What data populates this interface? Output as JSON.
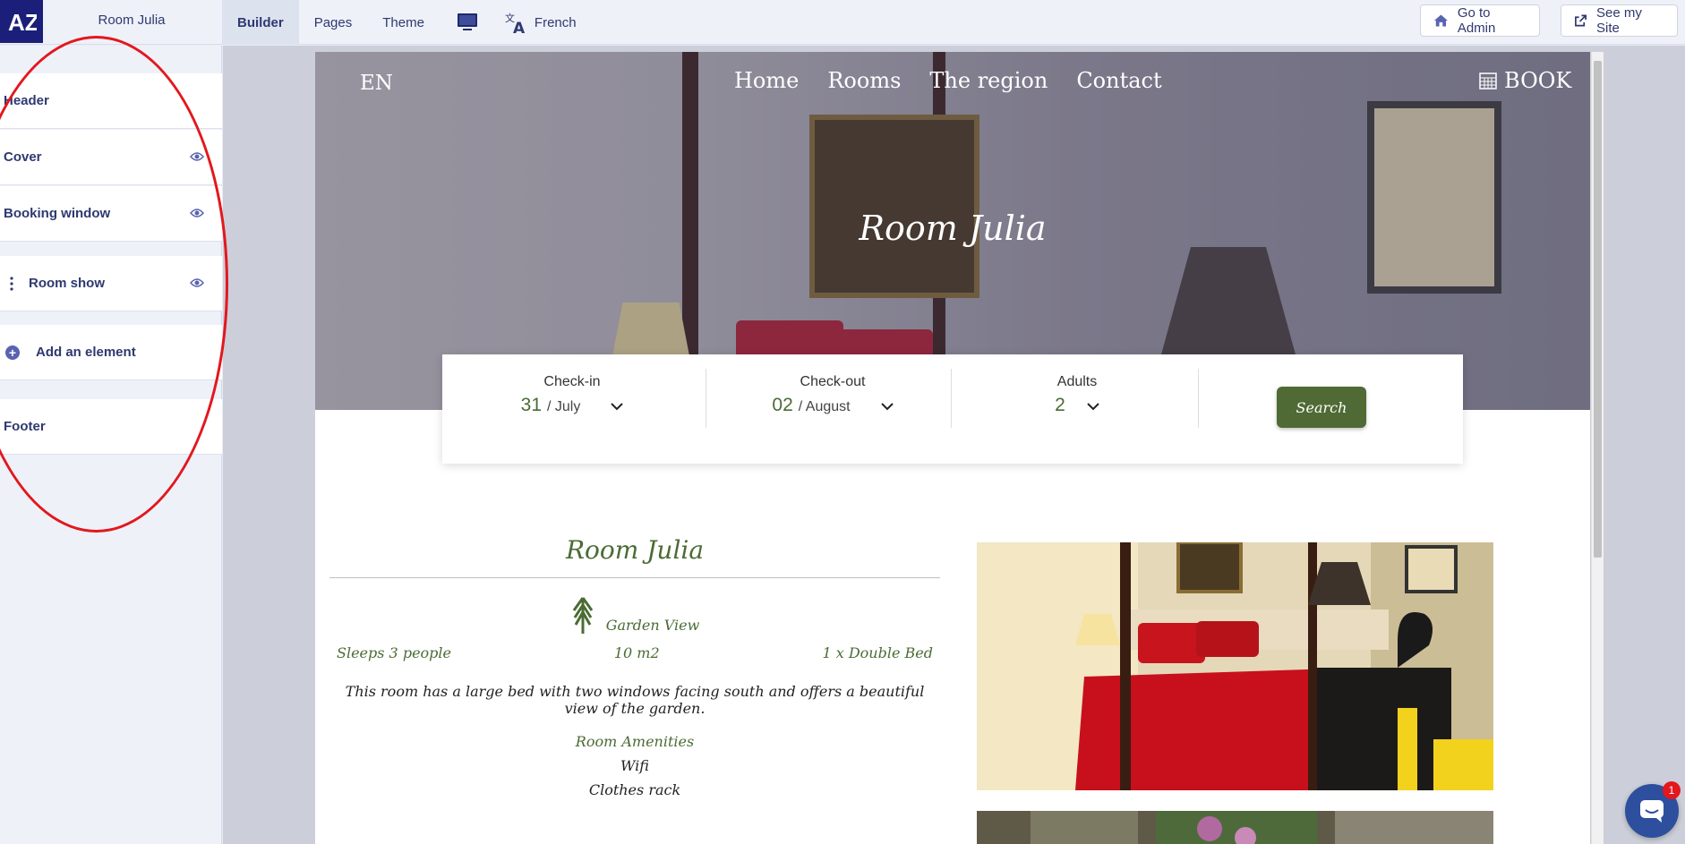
{
  "app": {
    "site_name": "Room Julia",
    "logo_text": "AZ",
    "tabs": [
      {
        "label": "Builder",
        "active": true
      },
      {
        "label": "Pages"
      },
      {
        "label": "Theme"
      }
    ],
    "language_label": "French",
    "go_admin_label": "Go to Admin",
    "see_site_label": "See my Site",
    "accent_color": "#1b1f7a"
  },
  "sections": [
    {
      "label": "Header",
      "visible_icon": false
    },
    {
      "label": "Cover",
      "visible_icon": true
    },
    {
      "label": "Booking window",
      "visible_icon": true
    },
    {
      "label": "Room show",
      "visible_icon": true
    },
    {
      "label": "Add an element"
    },
    {
      "label": "Footer",
      "visible_icon": false
    }
  ],
  "preview": {
    "lang": "EN",
    "nav": [
      "Home",
      "Rooms",
      "The region",
      "Contact"
    ],
    "book_label": "BOOK",
    "hero_title": "Room Julia",
    "booking": {
      "checkin_label": "Check-in",
      "checkin_day": "31",
      "checkin_month": "/ July",
      "checkout_label": "Check-out",
      "checkout_day": "02",
      "checkout_month": "/ August",
      "adults_label": "Adults",
      "adults_value": "2",
      "search_label": "Search"
    },
    "room": {
      "title": "Room Julia",
      "view": "Garden View",
      "sleeps": "Sleeps 3 people",
      "size": "10 m2",
      "bed": "1 x Double Bed",
      "description": "This room has a large bed with two windows facing south and offers a beautiful view of the garden.",
      "amenities_title": "Room Amenities",
      "amenities": [
        "Wifi",
        "Clothes rack"
      ]
    },
    "green_color": "#4b6b34"
  },
  "chat": {
    "badge": "1"
  },
  "annotation": {
    "color": "#e3171d"
  }
}
